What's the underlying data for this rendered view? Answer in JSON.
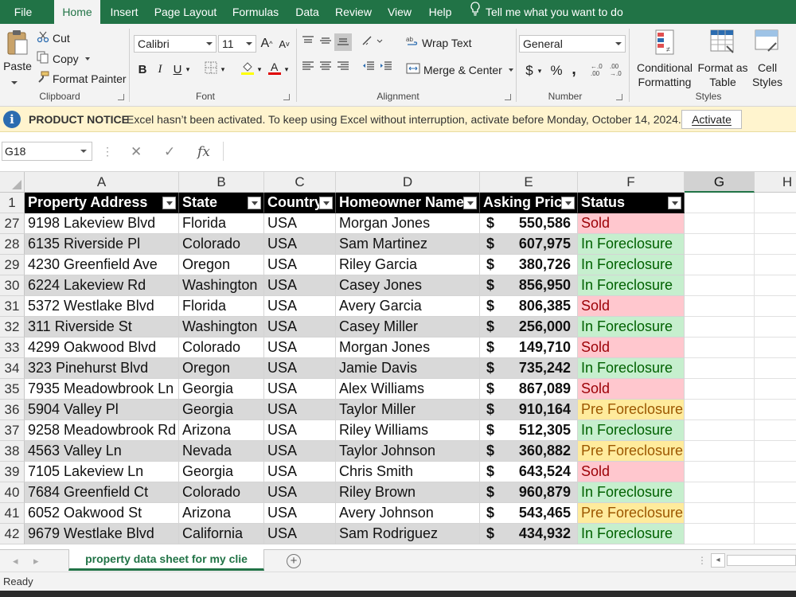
{
  "menu": {
    "tabs": [
      "File",
      "Home",
      "Insert",
      "Page Layout",
      "Formulas",
      "Data",
      "Review",
      "View",
      "Help"
    ],
    "active": "Home",
    "tell_me": "Tell me what you want to do"
  },
  "ribbon": {
    "clipboard": {
      "paste": "Paste",
      "cut": "Cut",
      "copy": "Copy",
      "format_painter": "Format Painter",
      "label": "Clipboard"
    },
    "font": {
      "name": "Calibri",
      "size": "11",
      "bold": "B",
      "italic": "I",
      "underline": "U",
      "label": "Font"
    },
    "alignment": {
      "wrap_text": "Wrap Text",
      "merge_center": "Merge & Center",
      "label": "Alignment"
    },
    "number": {
      "format": "General",
      "currency": "$",
      "percent": "%",
      "comma": ",",
      "label": "Number"
    },
    "styles": {
      "conditional_1": "Conditional",
      "conditional_2": "Formatting",
      "format_table_1": "Format as",
      "format_table_2": "Table",
      "cell_styles_1": "Cell",
      "cell_styles_2": "Styles",
      "label": "Styles"
    }
  },
  "notice": {
    "title": "PRODUCT NOTICE",
    "text": "Excel hasn’t been activated. To keep using Excel without interruption, activate before Monday, October 14, 2024.",
    "button": "Activate"
  },
  "formula_bar": {
    "name_box": "G18",
    "fx": "fx",
    "cancel": "✕",
    "enter": "✓",
    "value": ""
  },
  "columns": [
    "A",
    "B",
    "C",
    "D",
    "E",
    "F",
    "G",
    "H"
  ],
  "selected_column": "G",
  "table": {
    "header_row": "1",
    "headers": [
      "Property Address",
      "State",
      "Country",
      "Homeowner Name",
      "Asking Price",
      "Status"
    ],
    "rows": [
      {
        "n": "27",
        "address": "9198 Lakeview Blvd",
        "state": "Florida",
        "country": "USA",
        "owner": "Morgan Jones",
        "price": "550,586",
        "status": "Sold",
        "band": false
      },
      {
        "n": "28",
        "address": "6135 Riverside Pl",
        "state": "Colorado",
        "country": "USA",
        "owner": "Sam Martinez",
        "price": "607,975",
        "status": "In Foreclosure",
        "band": true
      },
      {
        "n": "29",
        "address": "4230 Greenfield Ave",
        "state": "Oregon",
        "country": "USA",
        "owner": "Riley Garcia",
        "price": "380,726",
        "status": "In Foreclosure",
        "band": false
      },
      {
        "n": "30",
        "address": "6224 Lakeview Rd",
        "state": "Washington",
        "country": "USA",
        "owner": "Casey Jones",
        "price": "856,950",
        "status": "In Foreclosure",
        "band": true
      },
      {
        "n": "31",
        "address": "5372 Westlake Blvd",
        "state": "Florida",
        "country": "USA",
        "owner": "Avery Garcia",
        "price": "806,385",
        "status": "Sold",
        "band": false
      },
      {
        "n": "32",
        "address": "311 Riverside St",
        "state": "Washington",
        "country": "USA",
        "owner": "Casey Miller",
        "price": "256,000",
        "status": "In Foreclosure",
        "band": true
      },
      {
        "n": "33",
        "address": "4299 Oakwood Blvd",
        "state": "Colorado",
        "country": "USA",
        "owner": "Morgan Jones",
        "price": "149,710",
        "status": "Sold",
        "band": false
      },
      {
        "n": "34",
        "address": "323 Pinehurst Blvd",
        "state": "Oregon",
        "country": "USA",
        "owner": "Jamie Davis",
        "price": "735,242",
        "status": "In Foreclosure",
        "band": true
      },
      {
        "n": "35",
        "address": "7935 Meadowbrook Ln",
        "state": "Georgia",
        "country": "USA",
        "owner": "Alex Williams",
        "price": "867,089",
        "status": "Sold",
        "band": false
      },
      {
        "n": "36",
        "address": "5904 Valley Pl",
        "state": "Georgia",
        "country": "USA",
        "owner": "Taylor Miller",
        "price": "910,164",
        "status": "Pre Foreclosure",
        "band": true
      },
      {
        "n": "37",
        "address": "9258 Meadowbrook Rd",
        "state": "Arizona",
        "country": "USA",
        "owner": "Riley Williams",
        "price": "512,305",
        "status": "In Foreclosure",
        "band": false
      },
      {
        "n": "38",
        "address": "4563 Valley Ln",
        "state": "Nevada",
        "country": "USA",
        "owner": "Taylor Johnson",
        "price": "360,882",
        "status": "Pre Foreclosure",
        "band": true
      },
      {
        "n": "39",
        "address": "7105 Lakeview Ln",
        "state": "Georgia",
        "country": "USA",
        "owner": "Chris Smith",
        "price": "643,524",
        "status": "Sold",
        "band": false
      },
      {
        "n": "40",
        "address": "7684 Greenfield Ct",
        "state": "Colorado",
        "country": "USA",
        "owner": "Riley Brown",
        "price": "960,879",
        "status": "In Foreclosure",
        "band": true
      },
      {
        "n": "41",
        "address": "6052 Oakwood St",
        "state": "Arizona",
        "country": "USA",
        "owner": "Avery Johnson",
        "price": "543,465",
        "status": "Pre Foreclosure",
        "band": false
      },
      {
        "n": "42",
        "address": "9679 Westlake Blvd",
        "state": "California",
        "country": "USA",
        "owner": "Sam Rodriguez",
        "price": "434,932",
        "status": "In Foreclosure",
        "band": true
      }
    ],
    "currency_symbol": "$"
  },
  "status_colors": {
    "Sold": "#ffc7ce",
    "In Foreclosure": "#c6efce",
    "Pre Foreclosure": "#ffeb9c"
  },
  "sheet_tab": "property data sheet for my clie",
  "status_bar": "Ready",
  "accent": "#217346"
}
